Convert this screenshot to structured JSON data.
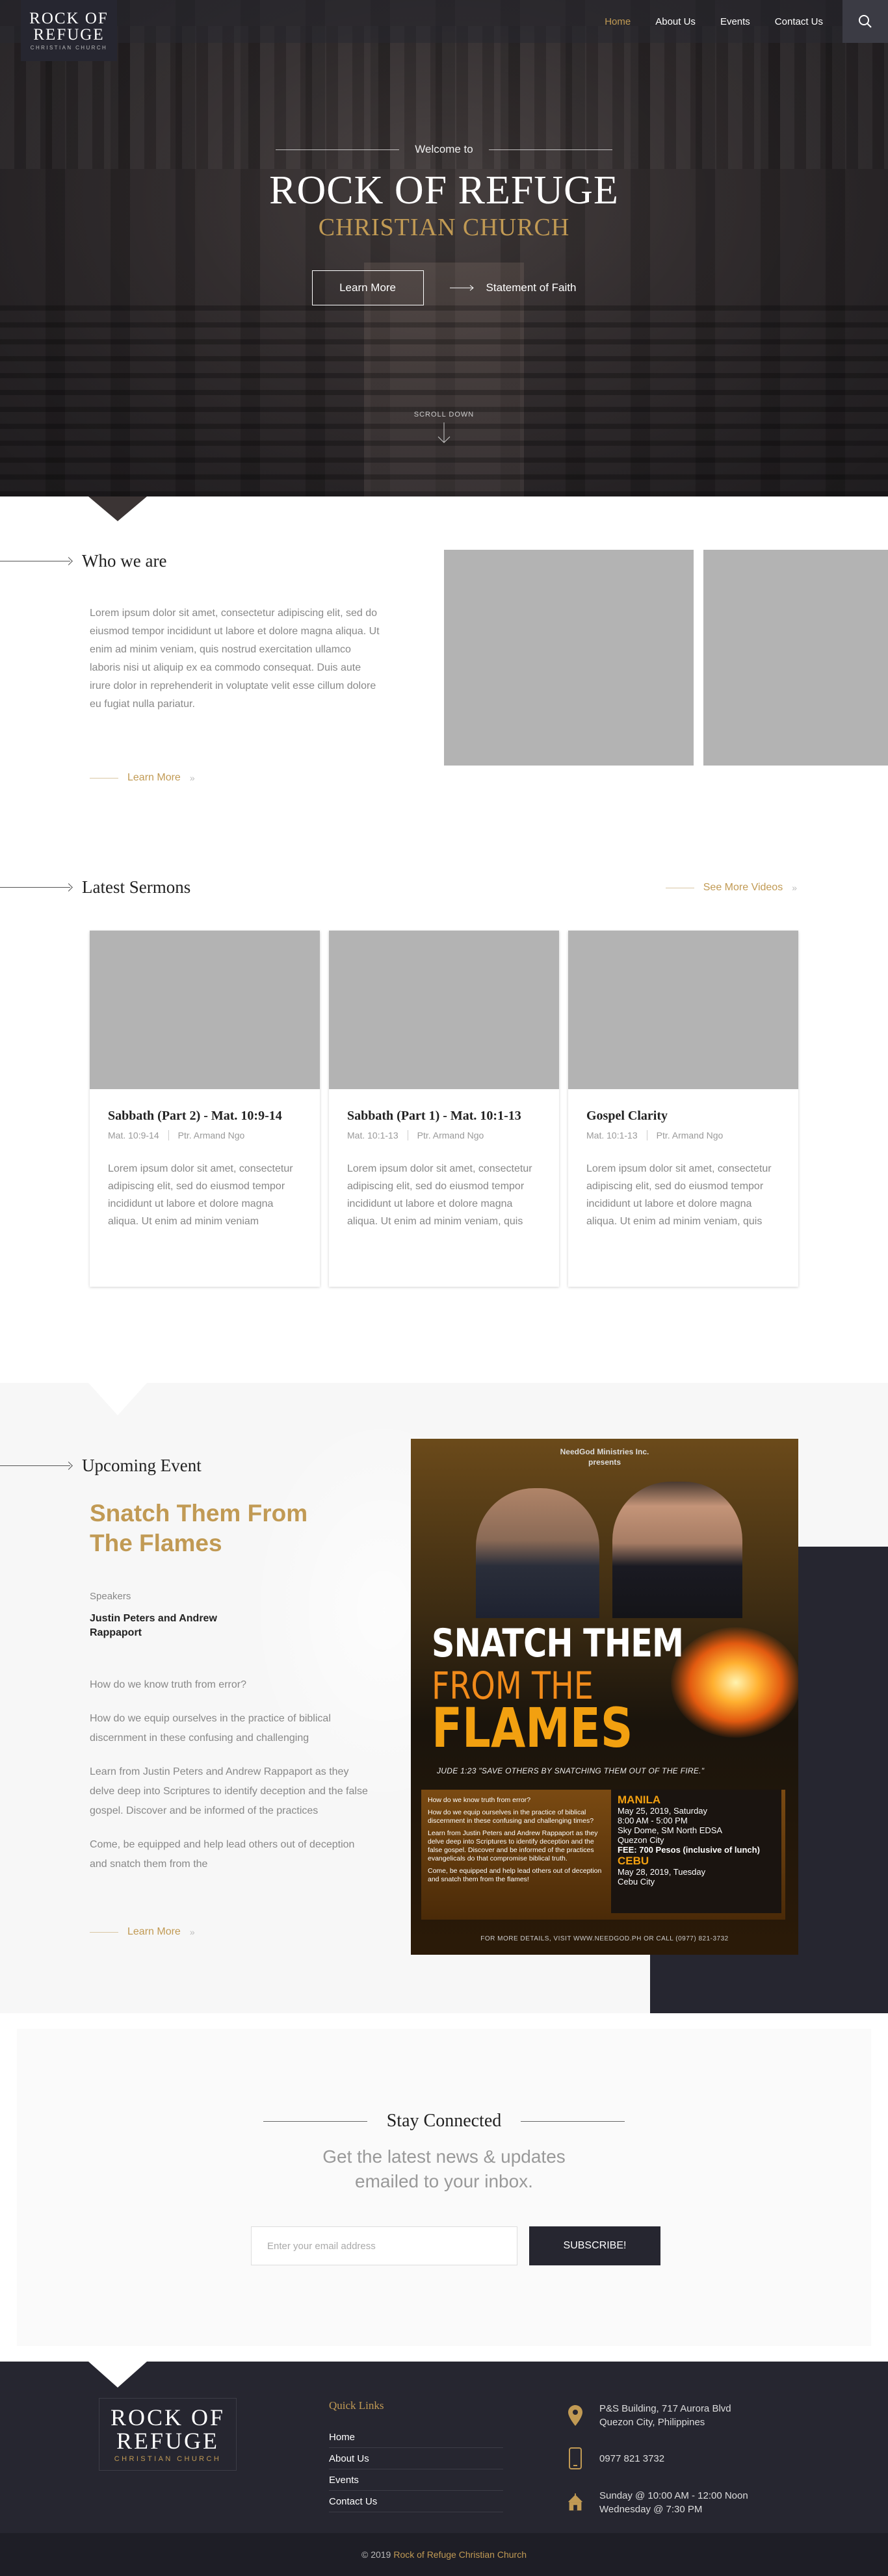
{
  "header": {
    "logo": {
      "line1": "ROCK OF",
      "line2": "REFUGE",
      "line3": "CHRISTIAN CHURCH"
    },
    "nav": [
      "Home",
      "About Us",
      "Events",
      "Contact Us"
    ],
    "active_nav": "Home"
  },
  "hero": {
    "welcome": "Welcome to",
    "title": "ROCK OF REFUGE",
    "subtitle": "CHRISTIAN CHURCH",
    "btn_learn": "Learn More",
    "link_statement": "Statement of Faith",
    "scroll": "SCROLL DOWN"
  },
  "who": {
    "title": "Who we are",
    "text": "Lorem ipsum dolor sit amet, consectetur adipiscing elit, sed do eiusmod tempor incididunt ut labore et dolore magna aliqua. Ut enim ad minim veniam, quis nostrud exercitation ullamco laboris nisi ut aliquip ex ea commodo consequat. Duis aute irure dolor in reprehenderit in voluptate velit esse cillum dolore eu fugiat nulla pariatur.",
    "more": "Learn More"
  },
  "sermons": {
    "title": "Latest Sermons",
    "more": "See More Videos",
    "items": [
      {
        "title": "Sabbath (Part 2) - Mat. 10:9-14",
        "ref": "Mat. 10:9-14",
        "pastor": "Ptr. Armand Ngo",
        "excerpt": "Lorem ipsum dolor sit amet, consectetur adipiscing elit, sed do eiusmod tempor incididunt ut labore et dolore magna aliqua. Ut enim ad minim veniam"
      },
      {
        "title": "Sabbath (Part 1) - Mat. 10:1-13",
        "ref": "Mat. 10:1-13",
        "pastor": "Ptr. Armand Ngo",
        "excerpt": "Lorem ipsum dolor sit amet, consectetur adipiscing elit, sed do eiusmod tempor incididunt ut labore et dolore magna aliqua. Ut enim ad minim veniam, quis"
      },
      {
        "title": "Gospel Clarity",
        "ref": "Mat. 10:1-13",
        "pastor": "Ptr. Armand Ngo",
        "excerpt": "Lorem ipsum dolor sit amet, consectetur adipiscing elit, sed do eiusmod tempor incididunt ut labore et dolore magna aliqua. Ut enim ad minim veniam, quis"
      }
    ]
  },
  "event": {
    "title": "Upcoming Event",
    "name": "Snatch Them From The Flames",
    "speakers_label": "Speakers",
    "speakers": "Justin Peters and Andrew Rappaport",
    "p1": "How do we know truth from error?",
    "p2": "How do we equip ourselves in the practice of biblical discernment in these confusing and challenging",
    "p3": "Learn from Justin Peters and Andrew Rappaport as they delve deep into Scriptures to identify deception and the false gospel. Discover and be informed of the practices",
    "p4": "Come, be equipped and help lead others out of deception and snatch them from the",
    "more": "Learn More",
    "poster": {
      "org": "NeedGod Ministries Inc.",
      "presents": "presents",
      "t1": "SNATCH THEM",
      "t2": "FROM THE",
      "t3": "FLAMES",
      "verse": "JUDE 1:23 \"SAVE OTHERS BY SNATCHING THEM OUT OF THE FIRE.\"",
      "q1": "How do we know truth from error?",
      "q2": "How do we equip ourselves in the practice of biblical discernment in these confusing and challenging times?",
      "q3": "Learn from Justin Peters and Andrew Rappaport as they delve deep into Scriptures to identify deception and the false gospel. Discover and be informed of the practices evangelicals do that compromise biblical truth.",
      "q4": "Come, be equipped and help lead others out of deception and snatch them from the flames!",
      "manila": "MANILA",
      "manila_date": "May 25, 2019, Saturday",
      "manila_time": "8:00 AM - 5:00 PM",
      "manila_venue": "Sky Dome, SM North EDSA",
      "manila_city": "Quezon City",
      "fee": "FEE: 700 Pesos (inclusive of lunch)",
      "cebu": "CEBU",
      "cebu_date": "May 28, 2019, Tuesday",
      "cebu_city": "Cebu City",
      "footer": "FOR MORE DETAILS, VISIT WWW.NEEDGOD.PH OR CALL (0977) 821-3732"
    }
  },
  "stay": {
    "title": "Stay Connected",
    "sub1": "Get the latest news & updates",
    "sub2": "emailed to your inbox.",
    "placeholder": "Enter your email address",
    "button": "SUBSCRIBE!"
  },
  "footer": {
    "logo": {
      "line1": "ROCK OF",
      "line2": "REFUGE",
      "line3": "CHRISTIAN CHURCH"
    },
    "quick_title": "Quick Links",
    "links": [
      "Home",
      "About Us",
      "Events",
      "Contact Us"
    ],
    "addr1": "P&S Building, 717 Aurora Blvd",
    "addr2": "Quezon City, Philippines",
    "phone": "0977 821 3732",
    "sched1": "Sunday @ 10:00 AM - 12:00 Noon",
    "sched2": "Wednesday @ 7:30 PM",
    "copy": "© 2019",
    "copy_name": "Rock of Refuge Christian Church"
  },
  "icons": {
    "search": "search-icon",
    "location": "map-pin-icon",
    "phone": "phone-icon",
    "church": "church-icon"
  },
  "colors": {
    "gold": "#c19a54",
    "dark": "#262630"
  }
}
